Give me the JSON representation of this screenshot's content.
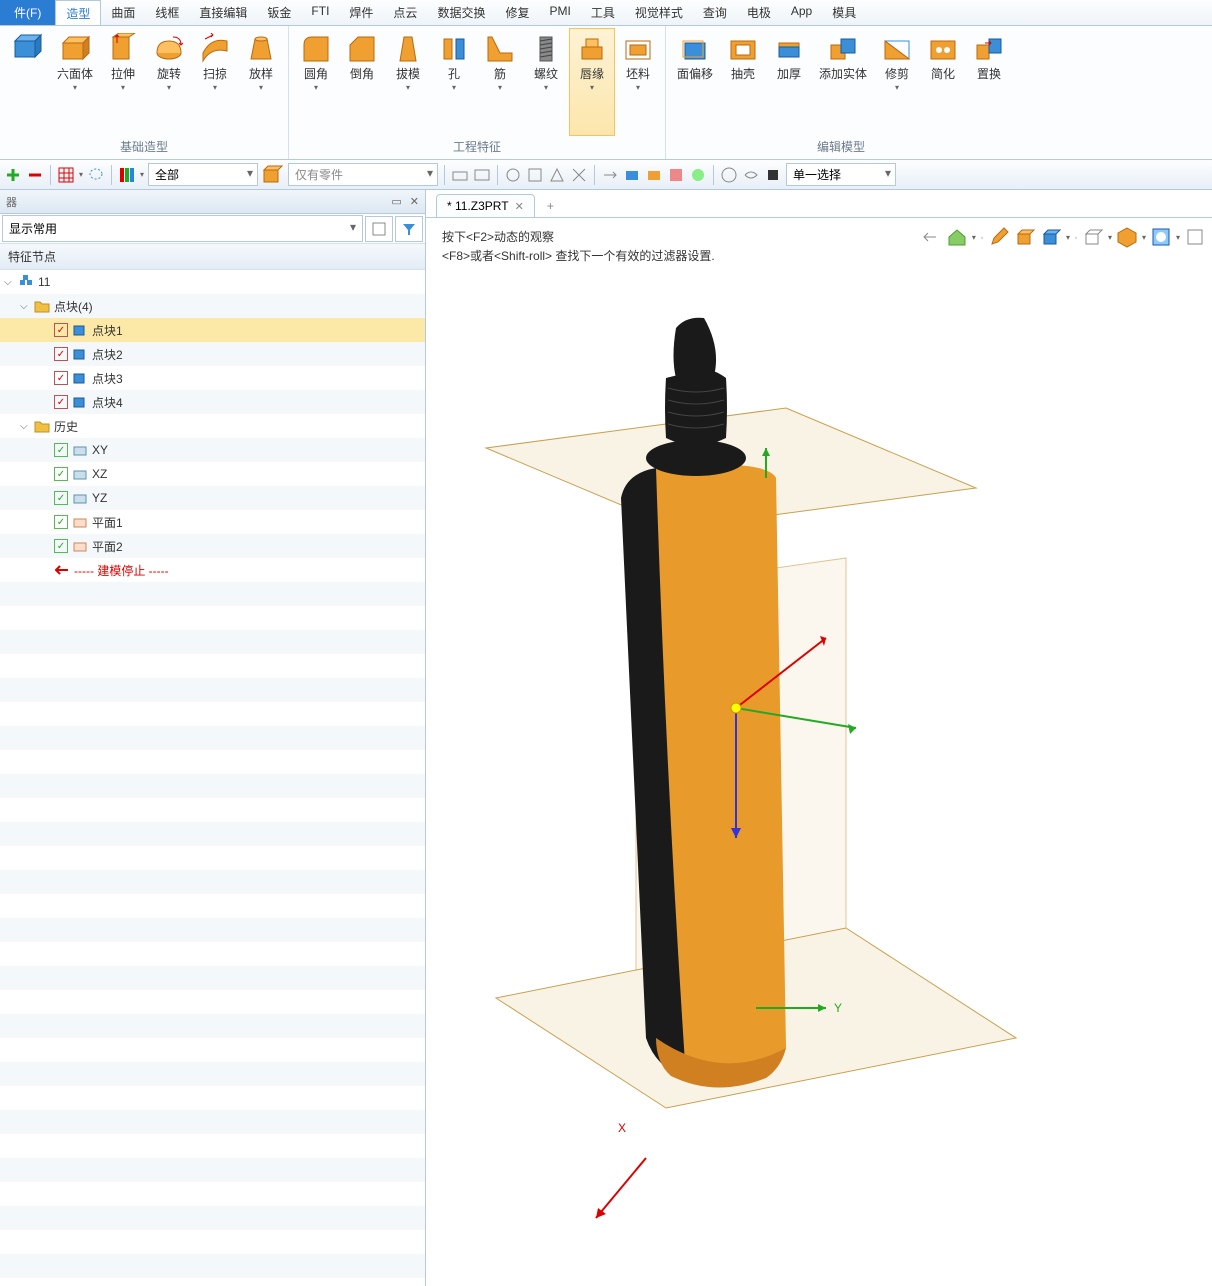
{
  "menu": {
    "file": "件(F)",
    "items": [
      "造型",
      "曲面",
      "线框",
      "直接编辑",
      "钣金",
      "FTI",
      "焊件",
      "点云",
      "数据交换",
      "修复",
      "PMI",
      "工具",
      "视觉样式",
      "查询",
      "电极",
      "App",
      "模具"
    ],
    "active_index": 0
  },
  "ribbon": {
    "groups": [
      {
        "label": "基础造型",
        "buttons": [
          {
            "label": "",
            "drop": false,
            "icon": "box-blue"
          },
          {
            "label": "六面体",
            "drop": true,
            "icon": "cube-orange"
          },
          {
            "label": "拉伸",
            "drop": true,
            "icon": "extrude"
          },
          {
            "label": "旋转",
            "drop": true,
            "icon": "revolve"
          },
          {
            "label": "扫掠",
            "drop": true,
            "icon": "sweep"
          },
          {
            "label": "放样",
            "drop": true,
            "icon": "loft"
          }
        ]
      },
      {
        "label": "工程特征",
        "buttons": [
          {
            "label": "圆角",
            "drop": true,
            "icon": "fillet"
          },
          {
            "label": "倒角",
            "drop": false,
            "icon": "chamfer"
          },
          {
            "label": "拔模",
            "drop": true,
            "icon": "draft"
          },
          {
            "label": "孔",
            "drop": true,
            "icon": "hole"
          },
          {
            "label": "筋",
            "drop": true,
            "icon": "rib"
          },
          {
            "label": "螺纹",
            "drop": true,
            "icon": "thread",
            "highlight": false
          },
          {
            "label": "唇缘",
            "drop": true,
            "icon": "lip",
            "highlight": true
          },
          {
            "label": "坯料",
            "drop": true,
            "icon": "stock"
          }
        ]
      },
      {
        "label": "编辑模型",
        "buttons": [
          {
            "label": "面偏移",
            "drop": false,
            "icon": "offset"
          },
          {
            "label": "抽壳",
            "drop": false,
            "icon": "shell"
          },
          {
            "label": "加厚",
            "drop": false,
            "icon": "thicken"
          },
          {
            "label": "添加实体",
            "drop": false,
            "icon": "addbody"
          },
          {
            "label": "修剪",
            "drop": true,
            "icon": "trim"
          },
          {
            "label": "简化",
            "drop": false,
            "icon": "simplify"
          },
          {
            "label": "置换",
            "drop": false,
            "icon": "replace"
          }
        ]
      }
    ]
  },
  "toolbar": {
    "filter1": "全部",
    "filter2": "仅有零件",
    "selection_mode": "单一选择"
  },
  "left_panel": {
    "title_char": "器",
    "display_filter": "显示常用",
    "section": "特征节点",
    "tree": {
      "root": "11",
      "point_blocks_folder": "点块(4)",
      "point_blocks": [
        "点块1",
        "点块2",
        "点块3",
        "点块4"
      ],
      "history_folder": "历史",
      "history_items": [
        "XY",
        "XZ",
        "YZ",
        "平面1",
        "平面2"
      ],
      "stop_marker": "----- 建模停止 -----"
    }
  },
  "viewport": {
    "tab_name": "* 11.Z3PRT",
    "hint_line1": "按下<F2>动态的观察",
    "hint_line2": "<F8>或者<Shift-roll> 查找下一个有效的过滤器设置.",
    "axis_x": "X",
    "axis_y": "Y"
  }
}
